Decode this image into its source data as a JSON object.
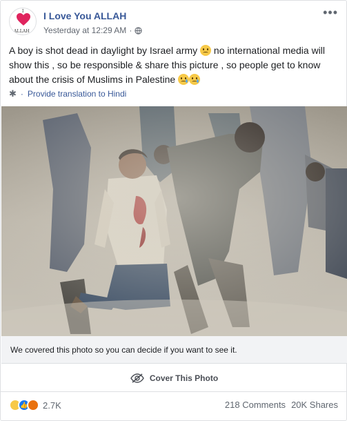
{
  "post": {
    "page_name": "I Love You ALLAH",
    "avatar": {
      "caption_top": "I",
      "caption_bottom": "ALLAH"
    },
    "timestamp": "Yesterday at 12:29 AM",
    "separator": "·",
    "privacy_icon": "globe-icon",
    "more_icon": "ellipsis-icon",
    "text": {
      "part1": "A boy is shot dead in daylight by Israel army ",
      "part2": " no international media will show this , so be responsible & share this picture , so people get to know about the crisis of Muslims in Palestine "
    },
    "translate": {
      "icon": "gear-icon",
      "separator": "·",
      "label": "Provide translation to Hindi"
    }
  },
  "photo": {
    "description_icon": "photo"
  },
  "sensitive": {
    "notice": "We covered this photo so you can decide if you want to see it.",
    "button_label": "Cover This Photo",
    "button_icon": "eye-slash-icon"
  },
  "footer": {
    "reaction_icons": [
      "sad-reaction-icon",
      "like-reaction-icon",
      "angry-reaction-icon"
    ],
    "reaction_count": "2.7K",
    "comments": "218 Comments",
    "shares": "20K Shares"
  },
  "colors": {
    "link": "#385898",
    "muted": "#616770",
    "divider": "#dddfe2",
    "bar_bg": "#f2f3f5",
    "heart": "#e0245e"
  }
}
